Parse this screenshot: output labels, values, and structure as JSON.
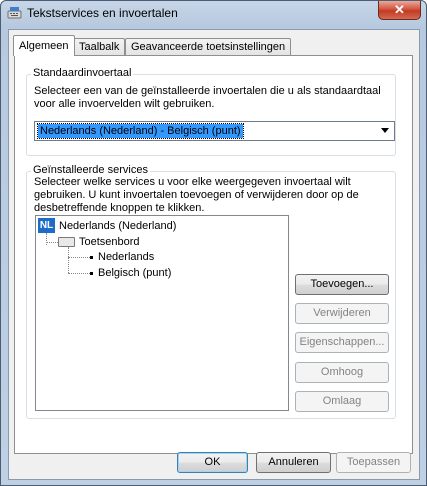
{
  "window": {
    "title": "Tekstservices en invoertalen",
    "close_label": "✕"
  },
  "tabs": [
    {
      "label": "Algemeen"
    },
    {
      "label": "Taalbalk"
    },
    {
      "label": "Geavanceerde toetsinstellingen"
    }
  ],
  "default_language": {
    "group_title": "Standaardinvoertaal",
    "description_line1": "Selecteer een van de geïnstalleerde invoertalen die u als standaardtaal",
    "description_line2": "voor alle invoervelden wilt gebruiken.",
    "selected_value": "Nederlands (Nederland) - Belgisch (punt)"
  },
  "installed_services": {
    "group_title": "Geïnstalleerde services",
    "description_line1": "Selecteer welke services u voor elke weergegeven invoertaal wilt",
    "description_line2": "gebruiken. U kunt invoertalen toevoegen of verwijderen door op de",
    "description_line3": "desbetreffende knoppen te klikken.",
    "tree": {
      "language_badge": "NL",
      "language": "Nederlands (Nederland)",
      "category": "Toetsenbord",
      "layouts": [
        "Nederlands",
        "Belgisch (punt)"
      ]
    },
    "buttons": {
      "add": "Toevoegen...",
      "remove": "Verwijderen",
      "properties": "Eigenschappen...",
      "move_up": "Omhoog",
      "move_down": "Omlaag"
    }
  },
  "footer": {
    "ok": "OK",
    "cancel": "Annuleren",
    "apply": "Toepassen"
  }
}
